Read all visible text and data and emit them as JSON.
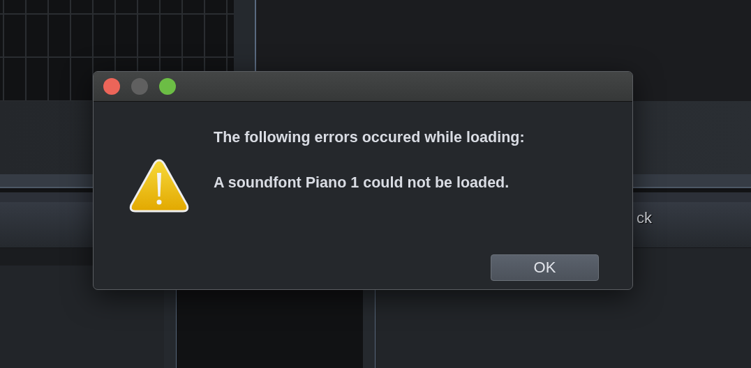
{
  "background": {
    "panel_header": "ck"
  },
  "dialog": {
    "message": "The following errors occured while loading:",
    "detail": "A soundfont Piano 1 could not be loaded.",
    "buttons": [
      "OK"
    ]
  }
}
